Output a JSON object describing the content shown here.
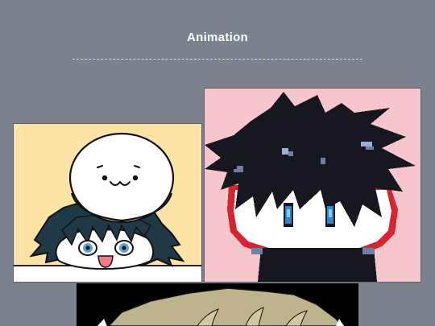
{
  "page": {
    "section_title": "Animation"
  },
  "gallery": {
    "items": [
      {
        "name": "chibi-with-mochi-artwork"
      },
      {
        "name": "pixel-art-character-artwork"
      },
      {
        "name": "cropped-blonde-character-artwork"
      }
    ]
  },
  "colors": {
    "page_background": "#7b818d",
    "title_text": "#ffffff",
    "divider": "#d7dae0",
    "art1_background": "#fde3a6",
    "art2_background": "#f6c6cc",
    "art3_background": "#000000"
  }
}
